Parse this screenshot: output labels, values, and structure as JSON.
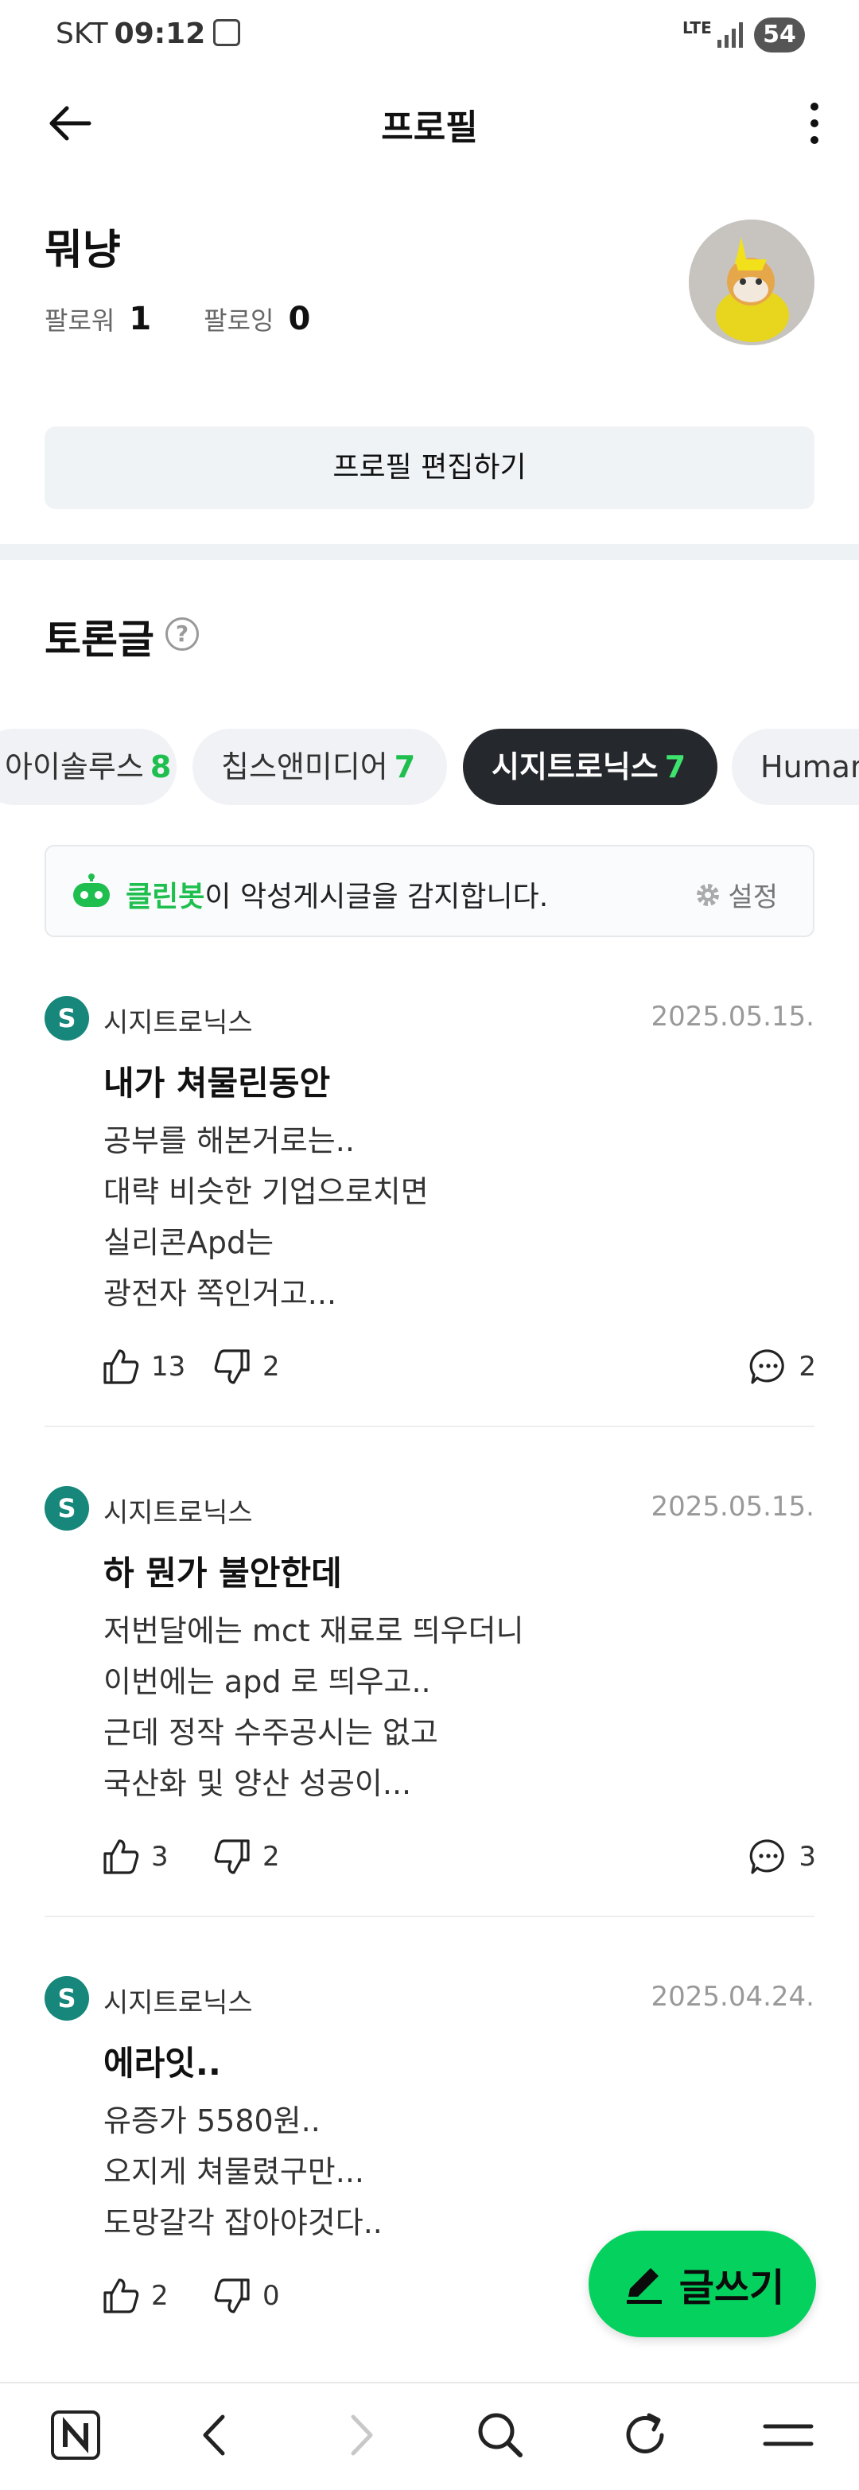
{
  "status_bar": {
    "carrier": "SKT",
    "time": "09:12",
    "network": "LTE",
    "battery": "54"
  },
  "header": {
    "title": "프로필"
  },
  "profile": {
    "name": "뭐냥",
    "followers_label": "팔로워",
    "followers_count": "1",
    "following_label": "팔로잉",
    "following_count": "0",
    "edit_button": "프로필 편집하기"
  },
  "section": {
    "title": "토론글",
    "help": "?"
  },
  "tabs": [
    {
      "label": "아이솔루스",
      "count": "8",
      "active": false
    },
    {
      "label": "칩스앤미디어",
      "count": "7",
      "active": false
    },
    {
      "label": "시지트로닉스",
      "count": "7",
      "active": true
    },
    {
      "label": "Human",
      "count": "",
      "active": false
    }
  ],
  "cleanbot": {
    "brand": "클린봇",
    "text": "이 악성게시글을 감지합니다.",
    "settings": "설정"
  },
  "posts": [
    {
      "board": "시지트로닉스",
      "date": "2025.05.15.",
      "title": "내가 쳐물린동안",
      "body": [
        "공부를 해본거로는..",
        "대략 비슷한 기업으로치면",
        "실리콘Apd는",
        "광전자 쪽인거고..."
      ],
      "likes": "13",
      "dislikes": "2",
      "comments": "2"
    },
    {
      "board": "시지트로닉스",
      "date": "2025.05.15.",
      "title": "하 뭔가 불안한데",
      "body": [
        "저번달에는 mct 재료로 띄우더니",
        "이번에는 apd 로 띄우고..",
        "근데 정작 수주공시는 없고",
        "국산화 및 양산 성공이..."
      ],
      "likes": "3",
      "dislikes": "2",
      "comments": "3"
    },
    {
      "board": "시지트로닉스",
      "date": "2025.04.24.",
      "title": "에라잇..",
      "body": [
        "유증가 5580원..",
        "오지게 쳐물렸구만...",
        "도망갈각 잡아야것다.."
      ],
      "likes": "2",
      "dislikes": "0",
      "comments": ""
    }
  ],
  "write_button": "글쓰기",
  "colors": {
    "accent_green": "#05d15e",
    "board_teal": "#16877a",
    "chip_active": "#25282c"
  }
}
